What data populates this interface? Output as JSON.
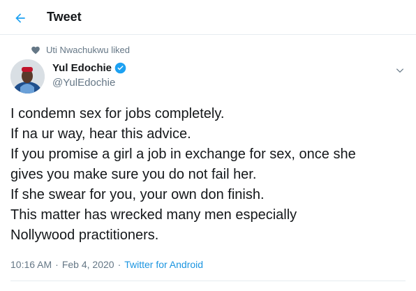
{
  "header": {
    "title": "Tweet"
  },
  "context": {
    "text": "Uti Nwachukwu liked"
  },
  "author": {
    "display_name": "Yul Edochie",
    "handle": "@YulEdochie",
    "verified": true
  },
  "tweet": {
    "lines": [
      "I condemn sex for jobs completely.",
      "If na ur way, hear this advice.",
      "If you promise a girl a job in exchange for sex, once she",
      "gives you make sure you do not fail her.",
      "If she swear for you, your own don finish.",
      "This matter has wrecked many men especially",
      "Nollywood practitioners."
    ]
  },
  "meta": {
    "time": "10:16 AM",
    "date": "Feb 4, 2020",
    "separator": "·",
    "source": "Twitter for Android"
  },
  "colors": {
    "accent": "#1da1f2",
    "secondary_text": "#657786",
    "divider": "#e6ecf0"
  },
  "icons": {
    "back": "arrow-left-icon",
    "context": "heart-icon",
    "verified": "verified-badge-icon",
    "menu": "chevron-down-icon"
  }
}
